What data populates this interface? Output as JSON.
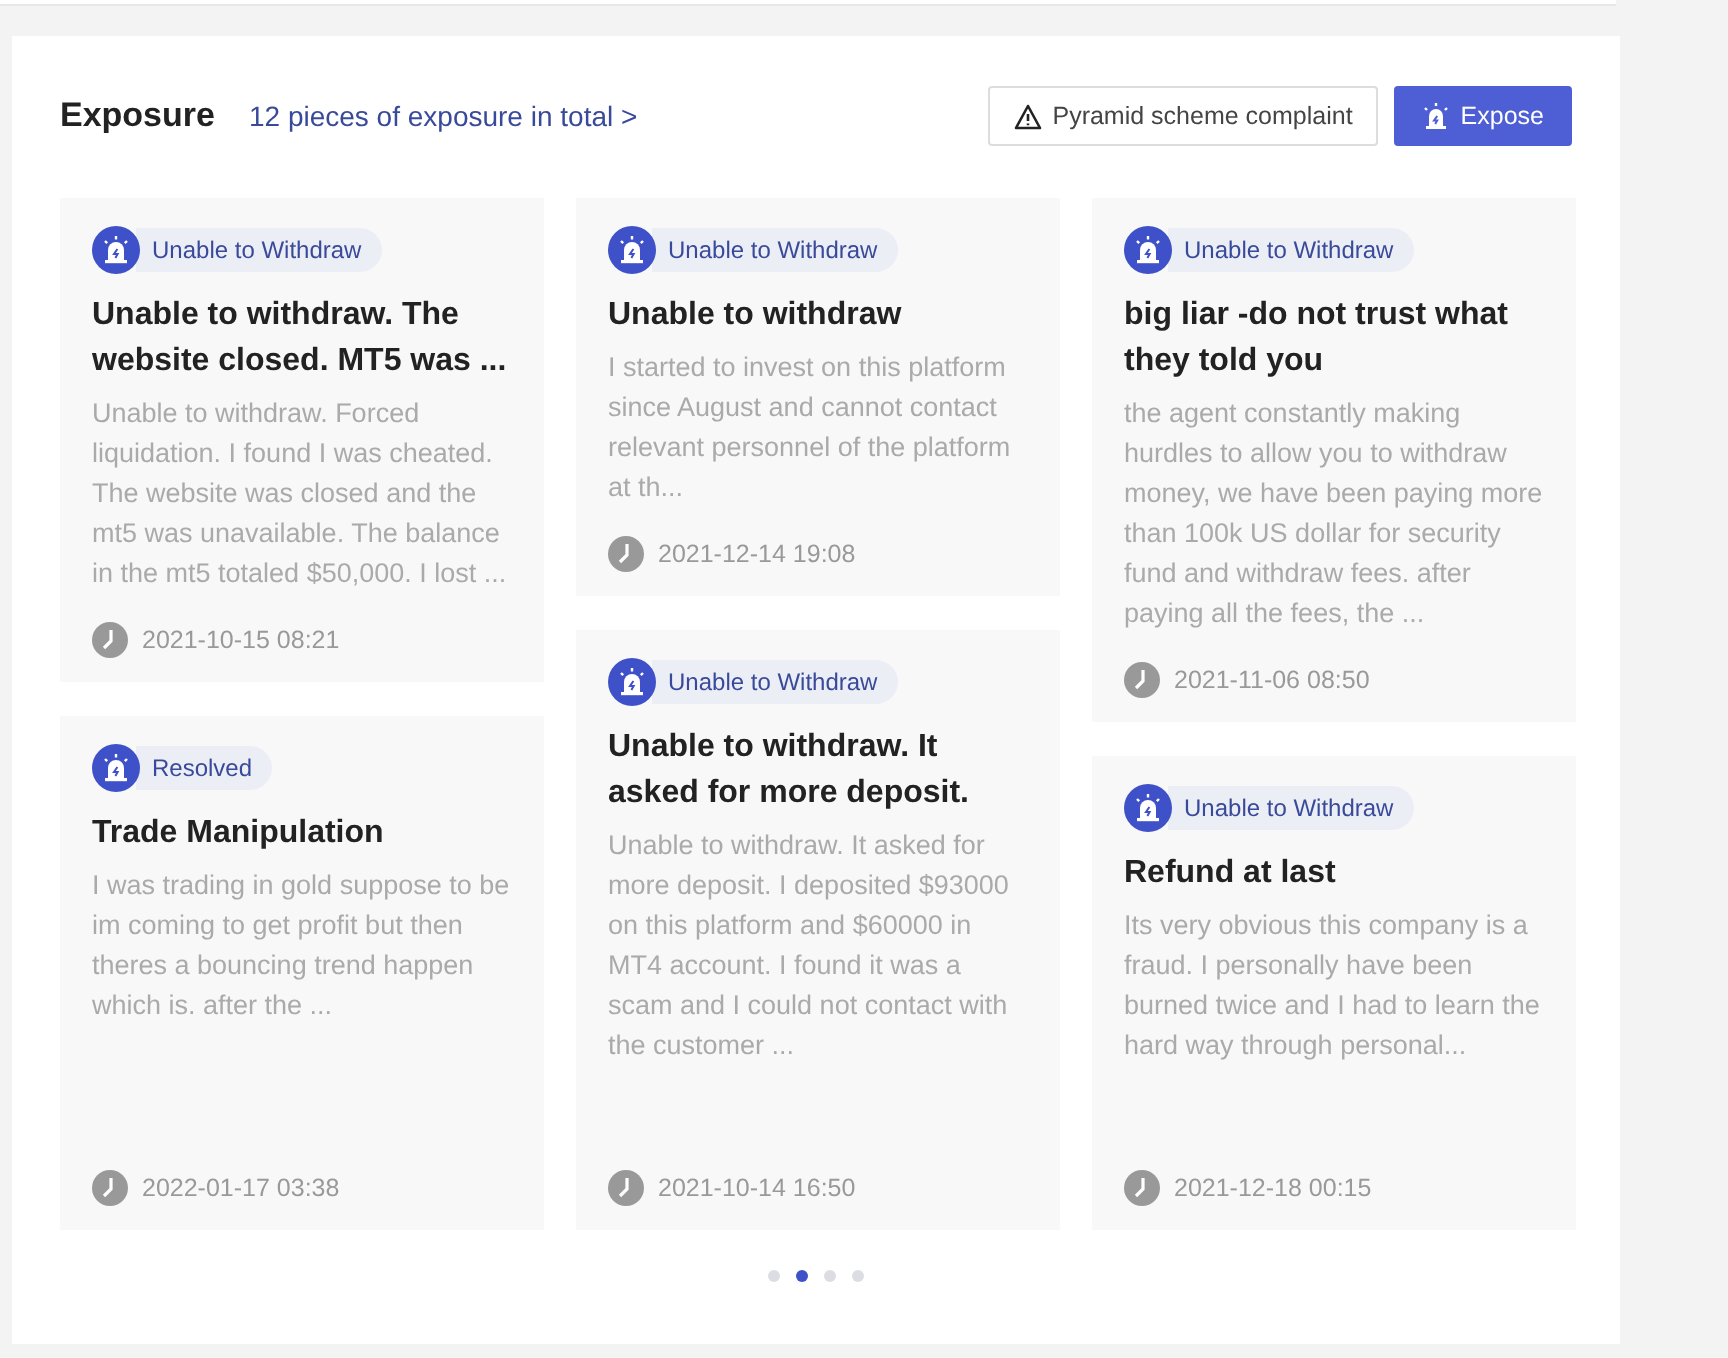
{
  "header": {
    "title": "Exposure",
    "total_link": "12 pieces of exposure in total >",
    "complaint_button": "Pyramid scheme complaint",
    "expose_button": "Expose"
  },
  "columns": [
    [
      {
        "tag": "Unable to Withdraw",
        "title": "Unable to withdraw. The website closed. MT5 was ...",
        "excerpt": "Unable to withdraw. Forced liquidation. I found I was cheated. The website was closed and the mt5 was unavailable. The balance in the mt5 totaled $50,000. I lost ...",
        "time": "2021-10-15 08:21"
      },
      {
        "tag": "Resolved",
        "title": "Trade Manipulation",
        "excerpt": "I was trading in gold suppose to be im coming to get profit but then theres a bouncing trend happen which is. after the ...",
        "time": "2022-01-17 03:38"
      }
    ],
    [
      {
        "tag": "Unable to Withdraw",
        "title": "Unable to withdraw",
        "excerpt": "I started to invest on this platform since August and cannot contact relevant personnel of the platform at th...",
        "time": "2021-12-14 19:08"
      },
      {
        "tag": "Unable to Withdraw",
        "title": "Unable to withdraw. It asked for more deposit.",
        "excerpt": "Unable to withdraw. It asked for more deposit. I deposited $93000 on this platform and $60000 in MT4 account. I found it was a scam and I could not contact with the customer ...",
        "time": "2021-10-14 16:50"
      }
    ],
    [
      {
        "tag": "Unable to Withdraw",
        "title": "big liar -do not trust what they told you",
        "excerpt": "the agent constantly making hurdles to allow you to withdraw money, we have been paying more than 100k US dollar for security fund and withdraw fees. after paying all the fees, the ...",
        "time": "2021-11-06 08:50"
      },
      {
        "tag": "Unable to Withdraw",
        "title": "Refund at last",
        "excerpt": "Its very obvious this company is a fraud. I personally have been burned twice and I had to learn the hard way through personal...",
        "time": "2021-12-18 00:15"
      }
    ]
  ],
  "pagination": [
    {
      "selected": false
    },
    {
      "selected": true
    },
    {
      "selected": false
    },
    {
      "selected": false
    }
  ]
}
